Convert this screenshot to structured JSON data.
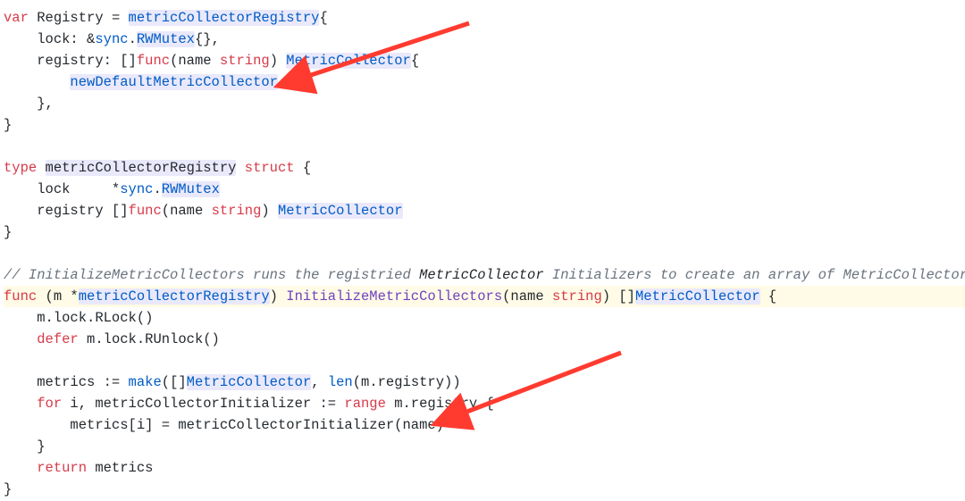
{
  "code": {
    "l1": {
      "var": "var",
      "reg": "Registry",
      "eq": " = ",
      "mcr": "metricCollectorRegistry",
      "brace": "{"
    },
    "l2": {
      "indent": "    ",
      "field": "lock: &",
      "sync": "sync",
      "dot": ".",
      "rwm": "RWMutex",
      "tail": "{},"
    },
    "l3": {
      "indent": "    ",
      "field": "registry: []",
      "func": "func",
      "sig1": "(name ",
      "str": "string",
      "sig2": ") ",
      "ret": "MetricCollector",
      "brace": "{"
    },
    "l4": {
      "indent": "        ",
      "id": "newDefaultMetricCollector",
      "tail": ","
    },
    "l5": {
      "txt": "    },"
    },
    "l6": {
      "txt": "}"
    },
    "l8": {
      "type": "type",
      "sp": " ",
      "name": "metricCollectorRegistry",
      "sp2": " ",
      "struct": "struct",
      "brace": " {"
    },
    "l9": {
      "indent": "    ",
      "field": "lock     *",
      "sync": "sync",
      "dot": ".",
      "rwm": "RWMutex"
    },
    "l10": {
      "indent": "    ",
      "field": "registry []",
      "func": "func",
      "sig1": "(name ",
      "str": "string",
      "sig2": ") ",
      "ret": "MetricCollector"
    },
    "l11": {
      "txt": "}"
    },
    "l13": {
      "c1": "// InitializeMetricCollectors",
      "c2": " runs the registried ",
      "em": "MetricCollector",
      "c3": " Initializers to create an array of MetricCollectors."
    },
    "l14": {
      "func": "func",
      "recv1": " (m *",
      "mcr": "metricCollectorRegistry",
      "recv2": ") ",
      "fn": "InitializeMetricCollectors",
      "sig1": "(name ",
      "str": "string",
      "sig2": ") []",
      "ret": "MetricCollector",
      "brace": " {"
    },
    "l15": {
      "txt": "    m.lock.RLock()"
    },
    "l16": {
      "indent": "    ",
      "defer": "defer",
      "txt": " m.lock.RUnlock()"
    },
    "l18": {
      "indent": "    ",
      "a": "metrics := ",
      "make": "make",
      "b": "([]",
      "ret": "MetricCollector",
      "c": ", ",
      "len": "len",
      "d": "(m.registry))"
    },
    "l19": {
      "indent": "    ",
      "for": "for",
      "a": " i, metricCollectorInitializer := ",
      "range": "range",
      "b": " m.registry {"
    },
    "l20": {
      "txt": "        metrics[i] = metricCollectorInitializer(name)"
    },
    "l21": {
      "txt": "    }"
    },
    "l22": {
      "indent": "    ",
      "return": "return",
      "txt": " metrics"
    },
    "l23": {
      "txt": "}"
    }
  }
}
